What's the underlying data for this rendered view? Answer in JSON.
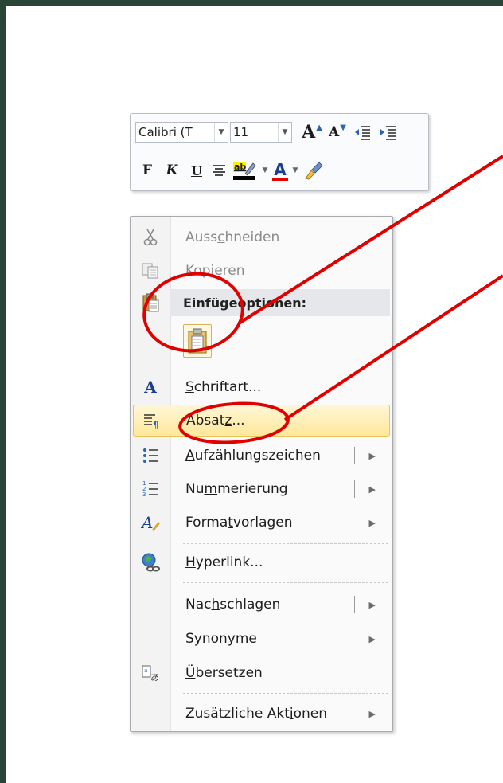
{
  "mini_toolbar": {
    "font_name": "Calibri (T",
    "font_size": "11",
    "grow_font_glyph": "A",
    "shrink_font_glyph": "A",
    "bold_glyph": "F",
    "italic_glyph": "K",
    "underline_glyph": "U",
    "highlight_glyph": "ab",
    "font_color_glyph": "A",
    "colors": {
      "font_color_bar": "#e60000",
      "highlight": "#000000"
    }
  },
  "context_menu": {
    "items": [
      {
        "pre": "Auss",
        "accel": "c",
        "post": "hneiden",
        "icon": "scissors-icon",
        "disabled": true
      },
      {
        "pre": "Kopieren",
        "accel": "",
        "post": "",
        "icon": "copy-icon",
        "disabled": true
      }
    ],
    "paste_header": "Einfügeoptionen:",
    "paste_option_icon": "paste-keep-text-icon",
    "items2": [
      {
        "pre": "",
        "accel": "S",
        "post": "chriftart...",
        "icon": "font-icon"
      },
      {
        "pre": "Absat",
        "accel": "z",
        "post": "...",
        "icon": "paragraph-icon",
        "highlighted": true
      },
      {
        "pre": "",
        "accel": "A",
        "post": "ufzählungszeichen",
        "icon": "bullets-icon",
        "split": true
      },
      {
        "pre": "Nu",
        "accel": "m",
        "post": "merierung",
        "icon": "numbering-icon",
        "split": true
      },
      {
        "pre": "Forma",
        "accel": "t",
        "post": "vorlagen",
        "icon": "styles-icon"
      },
      {
        "pre": "",
        "accel": "H",
        "post": "yperlink...",
        "icon": "hyperlink-icon"
      },
      {
        "pre": "Nac",
        "accel": "h",
        "post": "schlagen",
        "icon": "",
        "split": true
      },
      {
        "pre": "S",
        "accel": "y",
        "post": "nonyme",
        "icon": ""
      },
      {
        "pre": "",
        "accel": "Ü",
        "post": "bersetzen",
        "icon": "translate-icon"
      },
      {
        "pre": "Zusätzliche Akt",
        "accel": "i",
        "post": "onen",
        "icon": ""
      }
    ]
  },
  "annotation_color": "#e00000"
}
